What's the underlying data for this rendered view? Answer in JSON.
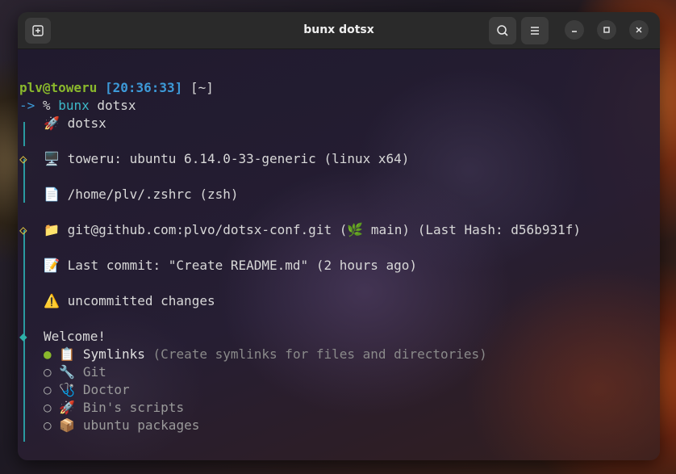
{
  "window": {
    "title": "bunx dotsx"
  },
  "prompt": {
    "user": "plv@toweru",
    "time": "[20:36:33]",
    "dir": "[~]",
    "arrow": "->",
    "symbol": "%",
    "command": "bunx",
    "arg": "dotsx"
  },
  "output": {
    "app_name_icon": "🚀",
    "app_name": "dotsx",
    "system_icon": "🖥️",
    "system": "toweru: ubuntu 6.14.0-33-generic (linux x64)",
    "shell_icon": "📄",
    "shell": "/home/plv/.zshrc (zsh)",
    "repo_icon": "📁",
    "repo_pre": "git@github.com:plvo/dotsx-conf.git (",
    "repo_branch_icon": "🌿",
    "repo_post": " main) (Last Hash: d56b931f)",
    "commit_icon": "📝",
    "commit": "Last commit: \"Create README.md\" (2 hours ago)",
    "warning_icon": "⚠️",
    "warning": "uncommitted changes"
  },
  "menu": {
    "welcome": "Welcome!",
    "options": [
      {
        "icon": "📋",
        "label": "Symlinks",
        "hint": "(Create symlinks for files and directories)",
        "selected": true
      },
      {
        "icon": "🔧",
        "label": "Git",
        "hint": "",
        "selected": false
      },
      {
        "icon": "🩺",
        "label": "Doctor",
        "hint": "",
        "selected": false
      },
      {
        "icon": "🚀",
        "label": "Bin's scripts",
        "hint": "",
        "selected": false
      },
      {
        "icon": "📦",
        "label": "ubuntu packages",
        "hint": "",
        "selected": false
      }
    ]
  },
  "glyphs": {
    "diamond_hollow": "◇",
    "diamond_filled": "◆",
    "radio_on": "●",
    "radio_off": "○"
  },
  "colors": {
    "user": "#8ab82c",
    "timestamp": "#3d9ad8",
    "rail": "#2a9aa0",
    "diamond_yellow": "#d8c040"
  }
}
